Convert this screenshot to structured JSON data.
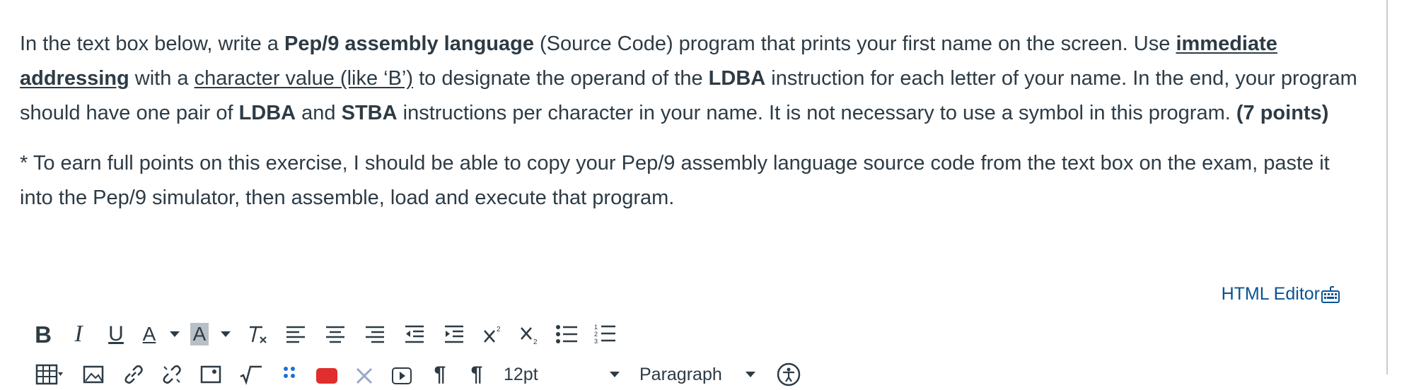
{
  "question": {
    "p1": [
      {
        "t": "In the text box below, write a ",
        "s": ""
      },
      {
        "t": "Pep/9 assembly language",
        "s": "b"
      },
      {
        "t": " (Source Code) program that prints your first name on the screen.  Use ",
        "s": ""
      },
      {
        "t": "immediate addressing",
        "s": "bu"
      },
      {
        "t": " with a ",
        "s": ""
      },
      {
        "t": "character value (like ‘B’)",
        "s": "u"
      },
      {
        "t": " to designate the operand of the ",
        "s": ""
      },
      {
        "t": "LDBA",
        "s": "b"
      },
      {
        "t": " instruction for each letter of your name.  In the end, your program should have one pair of ",
        "s": ""
      },
      {
        "t": "LDBA",
        "s": "b"
      },
      {
        "t": " and ",
        "s": ""
      },
      {
        "t": "STBA",
        "s": "b"
      },
      {
        "t": " instructions per character in your name.  It is not necessary to use a symbol in this program.  ",
        "s": ""
      },
      {
        "t": "(7 points)",
        "s": "b"
      }
    ],
    "p2": "* To earn full points on this exercise, I should be able to copy your Pep/9 assembly language source code from the text box on the exam, paste it into the Pep/9 simulator, then assemble, load and execute that program."
  },
  "editor": {
    "html_editor_label": "HTML Editor",
    "font_size_value": "12pt",
    "block_format_value": "Paragraph"
  },
  "icons": {
    "row1": [
      "bold-icon",
      "italic-icon",
      "underline-icon",
      "text-color-icon",
      "background-color-icon",
      "clear-formatting-icon",
      "align-left-icon",
      "align-center-icon",
      "align-right-icon",
      "outdent-icon",
      "indent-icon",
      "superscript-icon",
      "subscript-icon",
      "bullet-list-icon",
      "numbered-list-icon"
    ],
    "row2": [
      "table-icon",
      "image-icon",
      "link-icon",
      "unlink-icon",
      "embed-image-icon",
      "equation-icon",
      "apps-icon",
      "media-icon",
      "x-icon",
      "record-icon",
      "ltr-icon",
      "rtl-icon",
      "font-size-select",
      "paragraph-select",
      "accessibility-icon"
    ]
  }
}
